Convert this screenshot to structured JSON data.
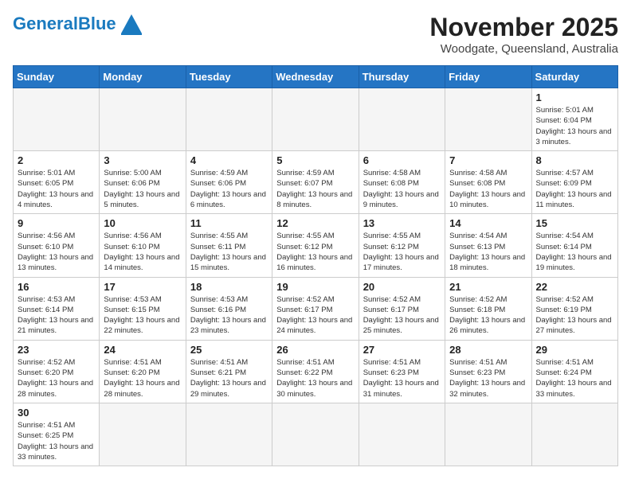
{
  "header": {
    "logo_general": "General",
    "logo_blue": "Blue",
    "month_title": "November 2025",
    "location": "Woodgate, Queensland, Australia"
  },
  "days_of_week": [
    "Sunday",
    "Monday",
    "Tuesday",
    "Wednesday",
    "Thursday",
    "Friday",
    "Saturday"
  ],
  "weeks": [
    [
      {
        "day": "",
        "info": ""
      },
      {
        "day": "",
        "info": ""
      },
      {
        "day": "",
        "info": ""
      },
      {
        "day": "",
        "info": ""
      },
      {
        "day": "",
        "info": ""
      },
      {
        "day": "",
        "info": ""
      },
      {
        "day": "1",
        "info": "Sunrise: 5:01 AM\nSunset: 6:04 PM\nDaylight: 13 hours\nand 3 minutes."
      }
    ],
    [
      {
        "day": "2",
        "info": "Sunrise: 5:01 AM\nSunset: 6:05 PM\nDaylight: 13 hours\nand 4 minutes."
      },
      {
        "day": "3",
        "info": "Sunrise: 5:00 AM\nSunset: 6:06 PM\nDaylight: 13 hours\nand 5 minutes."
      },
      {
        "day": "4",
        "info": "Sunrise: 4:59 AM\nSunset: 6:06 PM\nDaylight: 13 hours\nand 6 minutes."
      },
      {
        "day": "5",
        "info": "Sunrise: 4:59 AM\nSunset: 6:07 PM\nDaylight: 13 hours\nand 8 minutes."
      },
      {
        "day": "6",
        "info": "Sunrise: 4:58 AM\nSunset: 6:08 PM\nDaylight: 13 hours\nand 9 minutes."
      },
      {
        "day": "7",
        "info": "Sunrise: 4:58 AM\nSunset: 6:08 PM\nDaylight: 13 hours\nand 10 minutes."
      },
      {
        "day": "8",
        "info": "Sunrise: 4:57 AM\nSunset: 6:09 PM\nDaylight: 13 hours\nand 11 minutes."
      }
    ],
    [
      {
        "day": "9",
        "info": "Sunrise: 4:56 AM\nSunset: 6:10 PM\nDaylight: 13 hours\nand 13 minutes."
      },
      {
        "day": "10",
        "info": "Sunrise: 4:56 AM\nSunset: 6:10 PM\nDaylight: 13 hours\nand 14 minutes."
      },
      {
        "day": "11",
        "info": "Sunrise: 4:55 AM\nSunset: 6:11 PM\nDaylight: 13 hours\nand 15 minutes."
      },
      {
        "day": "12",
        "info": "Sunrise: 4:55 AM\nSunset: 6:12 PM\nDaylight: 13 hours\nand 16 minutes."
      },
      {
        "day": "13",
        "info": "Sunrise: 4:55 AM\nSunset: 6:12 PM\nDaylight: 13 hours\nand 17 minutes."
      },
      {
        "day": "14",
        "info": "Sunrise: 4:54 AM\nSunset: 6:13 PM\nDaylight: 13 hours\nand 18 minutes."
      },
      {
        "day": "15",
        "info": "Sunrise: 4:54 AM\nSunset: 6:14 PM\nDaylight: 13 hours\nand 19 minutes."
      }
    ],
    [
      {
        "day": "16",
        "info": "Sunrise: 4:53 AM\nSunset: 6:14 PM\nDaylight: 13 hours\nand 21 minutes."
      },
      {
        "day": "17",
        "info": "Sunrise: 4:53 AM\nSunset: 6:15 PM\nDaylight: 13 hours\nand 22 minutes."
      },
      {
        "day": "18",
        "info": "Sunrise: 4:53 AM\nSunset: 6:16 PM\nDaylight: 13 hours\nand 23 minutes."
      },
      {
        "day": "19",
        "info": "Sunrise: 4:52 AM\nSunset: 6:17 PM\nDaylight: 13 hours\nand 24 minutes."
      },
      {
        "day": "20",
        "info": "Sunrise: 4:52 AM\nSunset: 6:17 PM\nDaylight: 13 hours\nand 25 minutes."
      },
      {
        "day": "21",
        "info": "Sunrise: 4:52 AM\nSunset: 6:18 PM\nDaylight: 13 hours\nand 26 minutes."
      },
      {
        "day": "22",
        "info": "Sunrise: 4:52 AM\nSunset: 6:19 PM\nDaylight: 13 hours\nand 27 minutes."
      }
    ],
    [
      {
        "day": "23",
        "info": "Sunrise: 4:52 AM\nSunset: 6:20 PM\nDaylight: 13 hours\nand 28 minutes."
      },
      {
        "day": "24",
        "info": "Sunrise: 4:51 AM\nSunset: 6:20 PM\nDaylight: 13 hours\nand 28 minutes."
      },
      {
        "day": "25",
        "info": "Sunrise: 4:51 AM\nSunset: 6:21 PM\nDaylight: 13 hours\nand 29 minutes."
      },
      {
        "day": "26",
        "info": "Sunrise: 4:51 AM\nSunset: 6:22 PM\nDaylight: 13 hours\nand 30 minutes."
      },
      {
        "day": "27",
        "info": "Sunrise: 4:51 AM\nSunset: 6:23 PM\nDaylight: 13 hours\nand 31 minutes."
      },
      {
        "day": "28",
        "info": "Sunrise: 4:51 AM\nSunset: 6:23 PM\nDaylight: 13 hours\nand 32 minutes."
      },
      {
        "day": "29",
        "info": "Sunrise: 4:51 AM\nSunset: 6:24 PM\nDaylight: 13 hours\nand 33 minutes."
      }
    ],
    [
      {
        "day": "30",
        "info": "Sunrise: 4:51 AM\nSunset: 6:25 PM\nDaylight: 13 hours\nand 33 minutes."
      },
      {
        "day": "",
        "info": ""
      },
      {
        "day": "",
        "info": ""
      },
      {
        "day": "",
        "info": ""
      },
      {
        "day": "",
        "info": ""
      },
      {
        "day": "",
        "info": ""
      },
      {
        "day": "",
        "info": ""
      }
    ]
  ]
}
